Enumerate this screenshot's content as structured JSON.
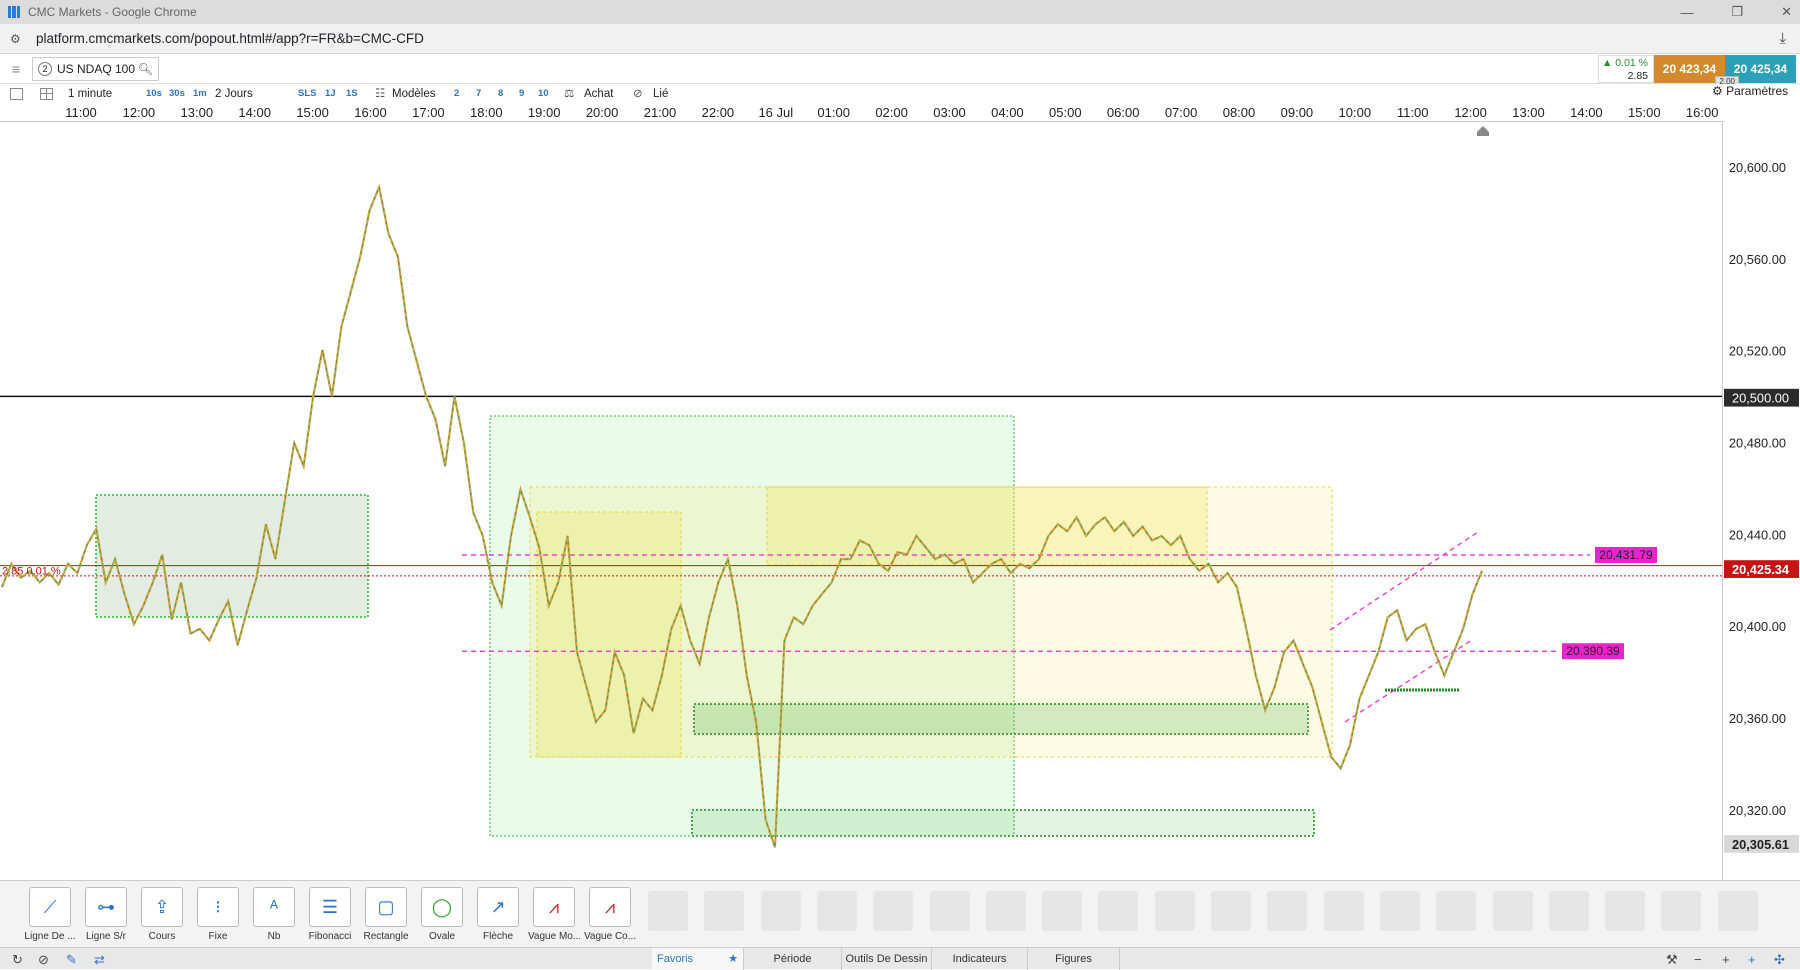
{
  "browser": {
    "title": "CMC Markets - Google Chrome",
    "url": "platform.cmcmarkets.com/popout.html#/app?r=FR&b=CMC-CFD"
  },
  "instrument": {
    "badge": "2",
    "name": "US NDAQ 100",
    "change_pct": "▲ 0.01 %",
    "change_pts": "2.85",
    "sell": "20 423,34",
    "buy": "20 425,34",
    "spread": "2.00"
  },
  "toolbar": {
    "interval": "1 minute",
    "quick_intervals": [
      "10s",
      "30s",
      "1m"
    ],
    "period": "2 Jours",
    "modes": [
      "SLS",
      "1J",
      "1S"
    ],
    "models": "Modèles",
    "counts": [
      "2",
      "7",
      "8",
      "9",
      "10"
    ],
    "buy": "Achat",
    "linked": "Lié",
    "settings": "Paramètres"
  },
  "x_axis": [
    "11:00",
    "12:00",
    "13:00",
    "14:00",
    "15:00",
    "16:00",
    "17:00",
    "18:00",
    "19:00",
    "20:00",
    "21:00",
    "22:00",
    "16 Jul",
    "01:00",
    "02:00",
    "03:00",
    "04:00",
    "05:00",
    "06:00",
    "07:00",
    "08:00",
    "09:00",
    "10:00",
    "11:00",
    "12:00",
    "13:00",
    "14:00",
    "15:00",
    "16:00"
  ],
  "y_axis": [
    "20,600.00",
    "20,560.00",
    "20,520.00",
    "20,480.00",
    "20,440.00",
    "20,400.00",
    "20,360.00",
    "20,320.00"
  ],
  "price_labels": {
    "resistance": "20,500.00",
    "current": "20,425.34",
    "low": "20,305.61",
    "line_upper": "20,431.79",
    "line_lower": "20,390.39",
    "left_tag": "2.85 0.01 %"
  },
  "chart_data": {
    "type": "line",
    "ylim": [
      20292,
      20618
    ],
    "series": [
      {
        "values": [
          20418,
          20428,
          20422,
          20425,
          20420,
          20424,
          20419,
          20428,
          20424,
          20436,
          20443,
          20420,
          20430,
          20415,
          20402,
          20410,
          20420,
          20432,
          20404,
          20420,
          20398,
          20400,
          20395,
          20404,
          20412,
          20393,
          20408,
          20422,
          20445,
          20430,
          20455,
          20480,
          20470,
          20500,
          20520,
          20500,
          20530,
          20545,
          20560,
          20580,
          20590,
          20570,
          20560,
          20530,
          20515,
          20500,
          20490,
          20470,
          20500,
          20480,
          20450,
          20440,
          20420,
          20410,
          20440,
          20460,
          20448,
          20435,
          20410,
          20420,
          20440,
          20390,
          20375,
          20360,
          20365,
          20390,
          20380,
          20355,
          20370,
          20365,
          20380,
          20400,
          20410,
          20395,
          20385,
          20405,
          20420,
          20430,
          20410,
          20380,
          20360,
          20318,
          20306,
          20395,
          20405,
          20402,
          20410,
          20415,
          20420,
          20430,
          20430,
          20438,
          20436,
          20428,
          20425,
          20433,
          20432,
          20440,
          20435,
          20430,
          20432,
          20428,
          20430,
          20420,
          20424,
          20428,
          20430,
          20424,
          20428,
          20426,
          20430,
          20440,
          20445,
          20442,
          20448,
          20440,
          20445,
          20448,
          20442,
          20446,
          20440,
          20444,
          20438,
          20440,
          20436,
          20440,
          20430,
          20425,
          20428,
          20420,
          20424,
          20418,
          20400,
          20380,
          20365,
          20375,
          20390,
          20395,
          20385,
          20375,
          20360,
          20345,
          20340,
          20350,
          20370,
          20380,
          20390,
          20405,
          20408,
          20395,
          20400,
          20402,
          20390,
          20380,
          20390,
          20400,
          20415,
          20425
        ]
      }
    ]
  },
  "drawing_tools": [
    "Ligne De ...",
    "Ligne S/r",
    "Cours",
    "Fixe",
    "Nb",
    "Fibonacci",
    "Rectangle",
    "Ovale",
    "Flèche",
    "Vague Mo...",
    "Vague Co..."
  ],
  "tabs": [
    "Favoris",
    "Période",
    "Outils De Dessin",
    "Indicateurs",
    "Figures"
  ],
  "colors": {
    "sell": "#d4892c",
    "buy": "#2aa1b8",
    "current_line": "#cc1111",
    "magenta": "#ee22cc",
    "green_zone": "#2db52d",
    "yellow_zone": "#e8d33a"
  }
}
